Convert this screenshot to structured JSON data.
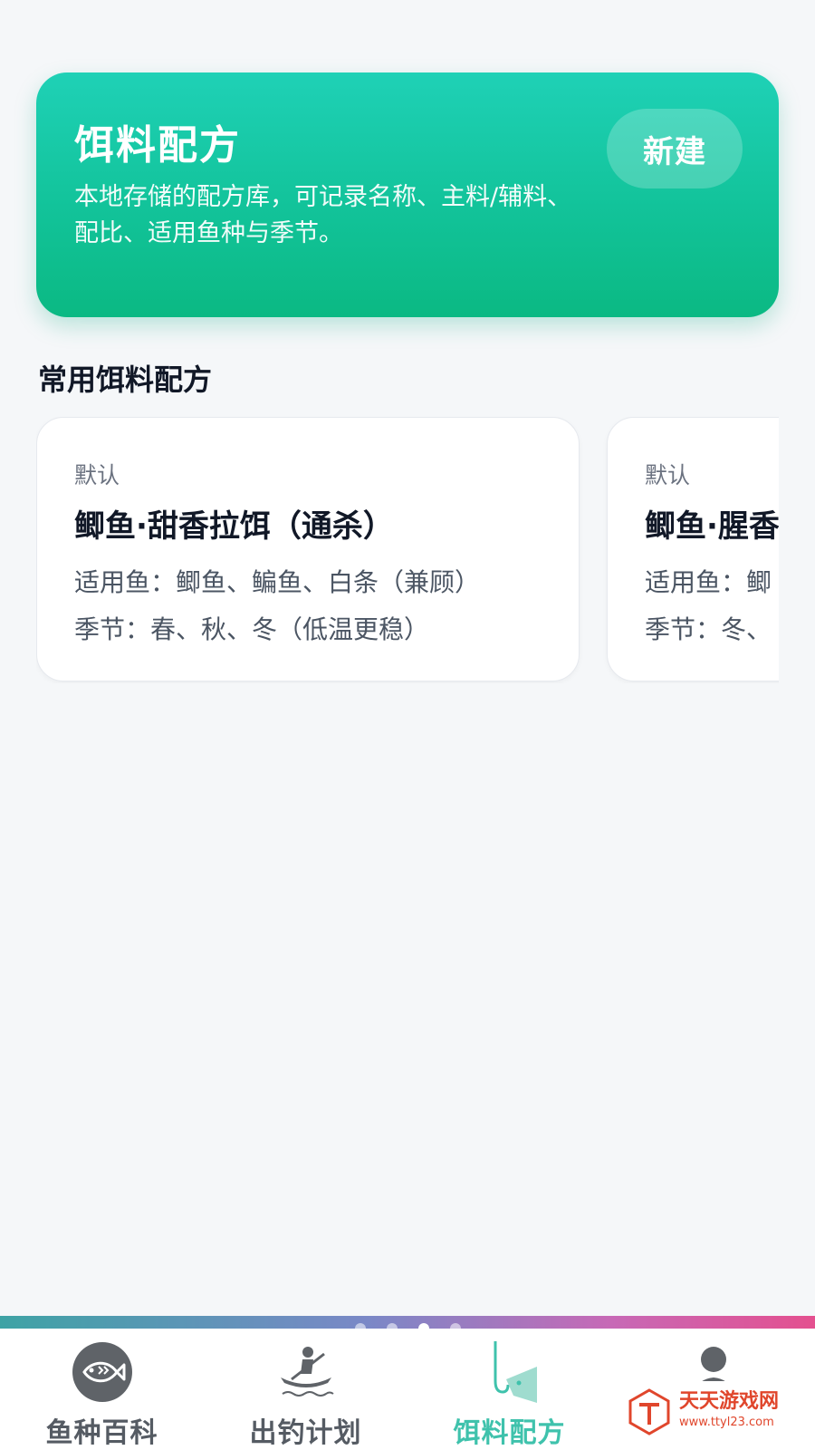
{
  "hero": {
    "title": "饵料配方",
    "description": "本地存储的配方库，可记录名称、主料/辅料、配比、适用鱼种与季节。",
    "new_button": "新建"
  },
  "section": {
    "title": "常用饵料配方"
  },
  "cards": [
    {
      "tag": "默认",
      "title": "鲫鱼·甜香拉饵（通杀）",
      "fish": "适用鱼：鲫鱼、鳊鱼、白条（兼顾）",
      "season": "季节：春、秋、冬（低温更稳）"
    },
    {
      "tag": "默认",
      "title": "鲫鱼·腥香",
      "fish": "适用鱼：鲫",
      "season": "季节：冬、"
    }
  ],
  "bottom_nav": {
    "items": [
      {
        "label": "鱼种百科",
        "icon": "fish-icon",
        "active": false
      },
      {
        "label": "出钓计划",
        "icon": "kayak-icon",
        "active": false
      },
      {
        "label": "饵料配方",
        "icon": "hook-bait-icon",
        "active": true
      },
      {
        "label": "",
        "icon": "user-icon",
        "active": false
      }
    ],
    "page_indicator": {
      "count": 4,
      "active_index": 2
    }
  },
  "colors": {
    "hero_gradient_top": "#1fd1b6",
    "hero_gradient_bottom": "#0bb983",
    "active_tab": "#3fc2ac",
    "page_background": "#f5f7f9"
  },
  "watermark": {
    "name": "天天游戏网",
    "url": "www.ttyl23.com"
  }
}
